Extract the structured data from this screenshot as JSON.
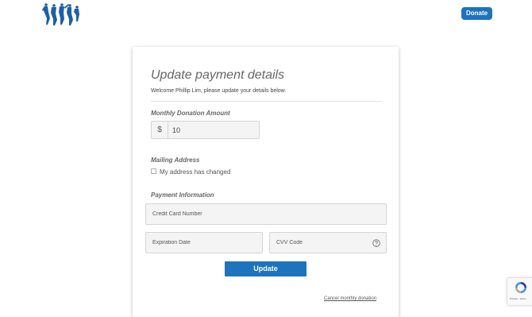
{
  "header": {
    "donate_label": "Donate"
  },
  "form": {
    "title": "Update payment details",
    "welcome": "Welcome Phillip Lim, please update your details below.",
    "amount": {
      "label": "Monthly Donation Amount",
      "currency": "$",
      "value": "10"
    },
    "mailing": {
      "label": "Mailing Address",
      "checkbox_label": "My address has changed",
      "checked": false
    },
    "payment": {
      "label": "Payment Information",
      "card_placeholder": "Credit Card Number",
      "expiry_placeholder": "Expiration Date",
      "cvv_placeholder": "CVV Code"
    },
    "submit_label": "Update",
    "cancel_label": "Cancel monthly donation"
  },
  "recaptcha": {
    "links": "Privacy - Terms"
  },
  "colors": {
    "accent": "#1e73be",
    "logo": "#1a5fa8",
    "field_bg": "#f4f4f4"
  },
  "icons": {
    "logo": "dancing-figures-logo",
    "help": "question-circle-icon",
    "recaptcha": "recaptcha-icon"
  }
}
